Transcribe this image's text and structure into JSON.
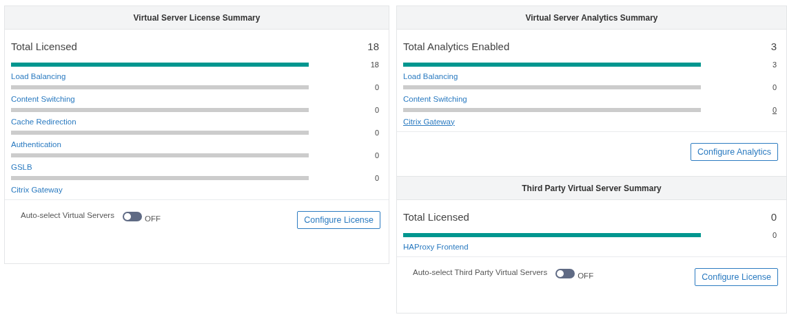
{
  "left_column": [
    {
      "title": "Virtual Server License Summary",
      "total": {
        "label": "Total Licensed",
        "value": "18"
      },
      "items": [
        {
          "label": "Load Balancing",
          "value": "18",
          "level": 1,
          "hovered": false
        },
        {
          "label": "Content Switching",
          "value": "0",
          "level": 0,
          "hovered": false
        },
        {
          "label": "Cache Redirection",
          "value": "0",
          "level": 0,
          "hovered": false
        },
        {
          "label": "Authentication",
          "value": "0",
          "level": 0,
          "hovered": false
        },
        {
          "label": "GSLB",
          "value": "0",
          "level": 0,
          "hovered": false
        },
        {
          "label": "Citrix Gateway",
          "value": "0",
          "level": 0,
          "hovered": false
        }
      ],
      "auto_select": {
        "label": "Auto-select Virtual Servers",
        "on": false,
        "state_label": "OFF"
      },
      "button": "Configure License"
    }
  ],
  "right_column": [
    {
      "title": "Virtual Server Analytics Summary",
      "total": {
        "label": "Total Analytics Enabled",
        "value": "3"
      },
      "items": [
        {
          "label": "Load Balancing",
          "value": "3",
          "level": 1,
          "hovered": false
        },
        {
          "label": "Content Switching",
          "value": "0",
          "level": 0,
          "hovered": false
        },
        {
          "label": "Citrix Gateway",
          "value": "0",
          "level": 0,
          "hovered": true
        }
      ],
      "button": "Configure Analytics"
    },
    {
      "title": "Third Party Virtual Server Summary",
      "total": {
        "label": "Total Licensed",
        "value": "0"
      },
      "items": [
        {
          "label": "HAProxy Frontend",
          "value": "0",
          "level": 1,
          "hovered": false
        }
      ],
      "auto_select": {
        "label": "Auto-select Third Party Virtual Servers",
        "on": false,
        "state_label": "OFF"
      },
      "button": "Configure License"
    }
  ]
}
